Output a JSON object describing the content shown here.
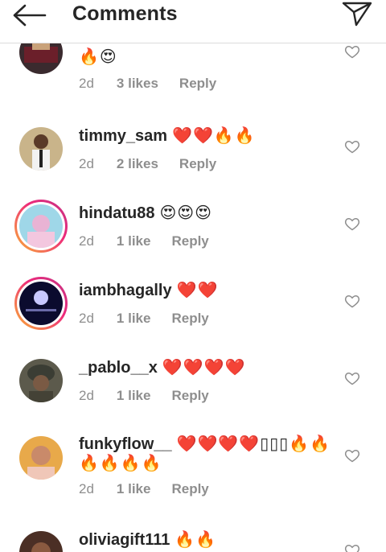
{
  "header": {
    "title": "Comments",
    "back_icon": "arrow-left-icon",
    "send_icon": "paper-plane-icon"
  },
  "comments": [
    {
      "username": "",
      "body": "🔥😍",
      "time": "2d",
      "likes": "3 likes",
      "reply": "Reply"
    },
    {
      "username": "timmy_sam",
      "body": "❤️❤️🔥🔥",
      "time": "2d",
      "likes": "2 likes",
      "reply": "Reply"
    },
    {
      "username": "hindatu88",
      "body": "😍😍😍",
      "time": "2d",
      "likes": "1 like",
      "reply": "Reply"
    },
    {
      "username": "iambhagally",
      "body": "❤️❤️",
      "time": "2d",
      "likes": "1 like",
      "reply": "Reply"
    },
    {
      "username": "_pablo__x",
      "body": "❤️❤️❤️❤️",
      "time": "2d",
      "likes": "1 like",
      "reply": "Reply"
    },
    {
      "username": "funkyflow__",
      "body": "❤️❤️❤️❤️▯▯▯🔥🔥 🔥🔥🔥🔥",
      "time": "2d",
      "likes": "1 like",
      "reply": "Reply"
    },
    {
      "username": "oliviagift111",
      "body": "🔥🔥",
      "time": "",
      "likes": "",
      "reply": ""
    }
  ],
  "colors": {
    "text": "#262626",
    "meta": "#8e8e8e",
    "divider": "#dbdbdb",
    "story_ring": "#ee2a7b"
  }
}
